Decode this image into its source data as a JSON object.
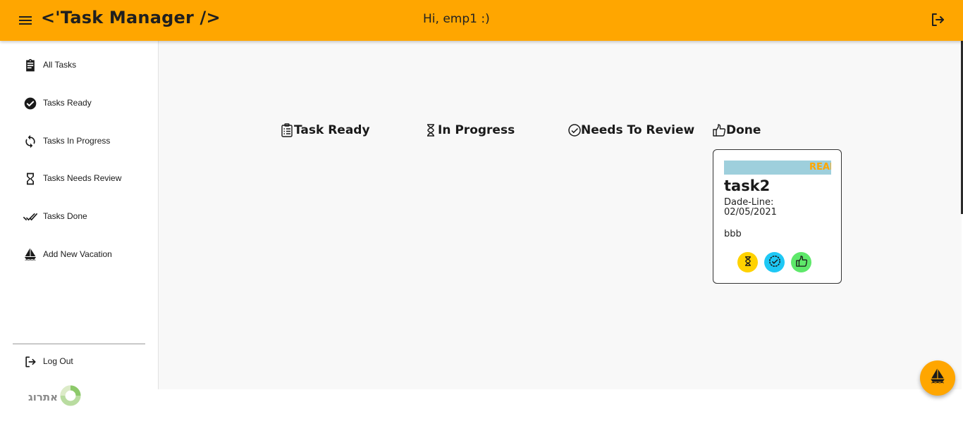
{
  "header": {
    "app_title": "<'Task Manager />",
    "greeting": "Hi, emp1 :)",
    "menu_icon": "hamburger-menu-icon",
    "logout_icon": "logout-icon",
    "background_color": "#ffa600"
  },
  "sidebar": {
    "items": [
      {
        "label": "All Tasks",
        "icon": "clipboard-icon"
      },
      {
        "label": "Tasks Ready",
        "icon": "check-circle-icon"
      },
      {
        "label": "Tasks In Progress",
        "icon": "sync-icon"
      },
      {
        "label": "Tasks Needs Review",
        "icon": "hourglass-icon"
      },
      {
        "label": "Tasks Done",
        "icon": "double-check-icon"
      },
      {
        "label": "Add New Vacation",
        "icon": "sailboat-icon"
      }
    ],
    "logout_label": "Log Out",
    "brand_text": "אתרוג"
  },
  "board": {
    "columns": [
      {
        "title": "Task Ready",
        "icon": "checklist-icon"
      },
      {
        "title": "In Progress",
        "icon": "hourglass-icon"
      },
      {
        "title": "Needs To Review",
        "icon": "check-circle-outline-icon"
      },
      {
        "title": "Done",
        "icon": "thumbs-up-icon"
      }
    ],
    "card": {
      "status": "READY",
      "title": "task2",
      "deadline_label": "Dade-Line:",
      "deadline_value": "02/05/2021",
      "description": "bbb",
      "actions": [
        {
          "name": "move-to-in-progress",
          "icon": "hourglass-icon",
          "color": "#ffd200"
        },
        {
          "name": "move-to-review",
          "icon": "check-circle-outline-icon",
          "color": "#1ec8f5"
        },
        {
          "name": "move-to-done",
          "icon": "thumbs-up-icon",
          "color": "#5ee86a"
        }
      ]
    }
  },
  "fab": {
    "icon": "sailboat-icon",
    "color": "#ffa600"
  }
}
